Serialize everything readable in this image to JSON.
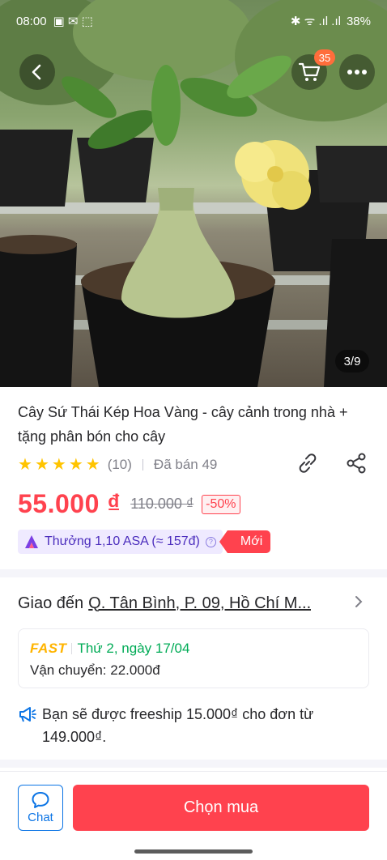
{
  "status_bar": {
    "time": "08:00",
    "battery": "38%"
  },
  "header": {
    "cart_count": "35",
    "image_counter": "3/9"
  },
  "product": {
    "title": "Cây Sứ Thái Kép Hoa Vàng - cây cảnh trong nhà + tặng phân bón cho cây",
    "rating_stars": 5,
    "rating_count": "(10)",
    "sold": "Đã bán 49",
    "price": "55.000 ₫",
    "old_price": "110.000 ₫",
    "discount": "-50%",
    "reward": "Thưởng 1,10 ASA (≈ 157đ)",
    "new_badge": "Mới"
  },
  "delivery": {
    "label": "Giao đến",
    "address": "Q. Tân Bình, P. 09, Hồ Chí M...",
    "fast_label": "FAST",
    "date": "Thứ 2, ngày 17/04",
    "shipping_fee": "Vận chuyển: 22.000đ",
    "freeship_line1": "Bạn sẽ được freeship 15.000₫ cho đơn từ",
    "freeship_line2": "149.000₫."
  },
  "actions": {
    "chat_label": "Chat",
    "buy_label": "Chọn mua"
  },
  "colors": {
    "price": "#ff424e",
    "accent_blue": "#0b74e5",
    "fast": "#ffb400",
    "date_green": "#00ab56",
    "reward_purple": "#4b2dbd"
  }
}
